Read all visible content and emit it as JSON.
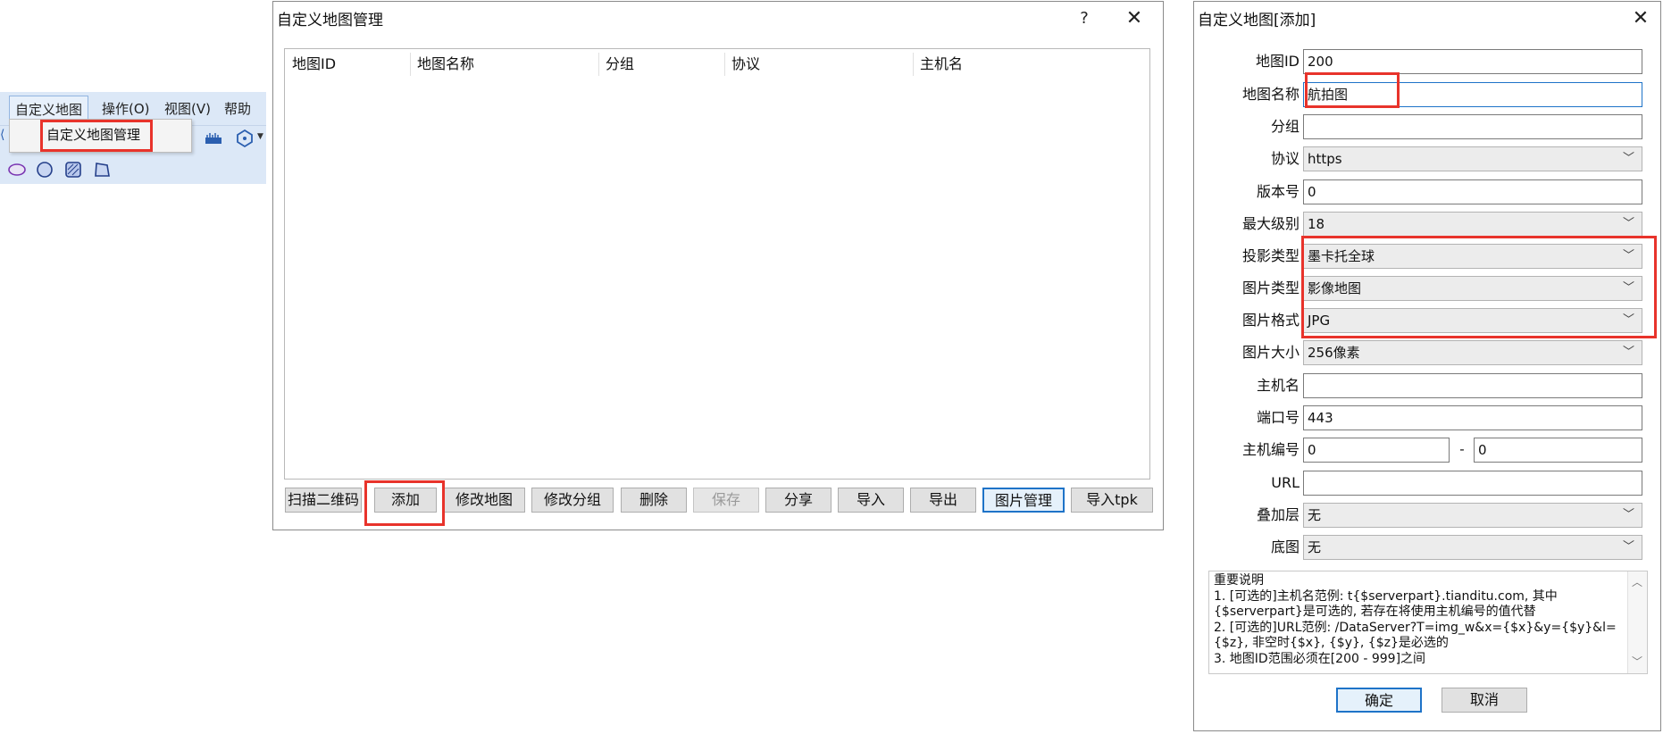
{
  "menu": {
    "items": [
      "自定义地图",
      "操作(O)",
      "视图(V)",
      "帮助(H"
    ],
    "dropdown_item": "自定义地图管理"
  },
  "manager": {
    "title": "自定义地图管理",
    "help_glyph": "?",
    "close_glyph": "✕",
    "columns": [
      "地图ID",
      "地图名称",
      "分组",
      "协议",
      "主机名"
    ],
    "buttons": [
      "扫描二维码",
      "添加",
      "修改地图",
      "修改分组",
      "删除",
      "保存",
      "分享",
      "导入",
      "导出",
      "图片管理",
      "导入tpk"
    ]
  },
  "add_dialog": {
    "title": "自定义地图[添加]",
    "close_glyph": "✕",
    "fields": {
      "map_id": {
        "label": "地图ID",
        "value": "200"
      },
      "map_name": {
        "label": "地图名称",
        "value": "航拍图"
      },
      "group": {
        "label": "分组",
        "value": ""
      },
      "protocol": {
        "label": "协议",
        "value": "https"
      },
      "version": {
        "label": "版本号",
        "value": "0"
      },
      "max_level": {
        "label": "最大级别",
        "value": "18"
      },
      "projection": {
        "label": "投影类型",
        "value": "墨卡托全球"
      },
      "image_type": {
        "label": "图片类型",
        "value": "影像地图"
      },
      "image_format": {
        "label": "图片格式",
        "value": "JPG"
      },
      "image_size": {
        "label": "图片大小",
        "value": "256像素"
      },
      "host": {
        "label": "主机名",
        "value": ""
      },
      "port": {
        "label": "端口号",
        "value": "443"
      },
      "host_num": {
        "label": "主机编号",
        "from": "0",
        "sep": "-",
        "to": "0"
      },
      "url": {
        "label": "URL",
        "value": ""
      },
      "overlay": {
        "label": "叠加层",
        "value": "无"
      },
      "basemap": {
        "label": "底图",
        "value": "无"
      }
    },
    "notes": [
      "重要说明",
      "1. [可选的]主机名范例: t{$serverpart}.tianditu.com, 其中",
      "{$serverpart}是可选的, 若存在将使用主机编号的值代替",
      "2. [可选的]URL范例: /DataServer?T=img_w&x={$x}&y={$y}&l=",
      "{$z}, 非空时{$x}, {$y}, {$z}是必选的",
      "3. 地图ID范围必须在[200 - 999]之间"
    ],
    "ok": "确定",
    "cancel": "取消"
  },
  "colors": {
    "highlight": "#e8332b",
    "accent": "#1e73c8"
  }
}
